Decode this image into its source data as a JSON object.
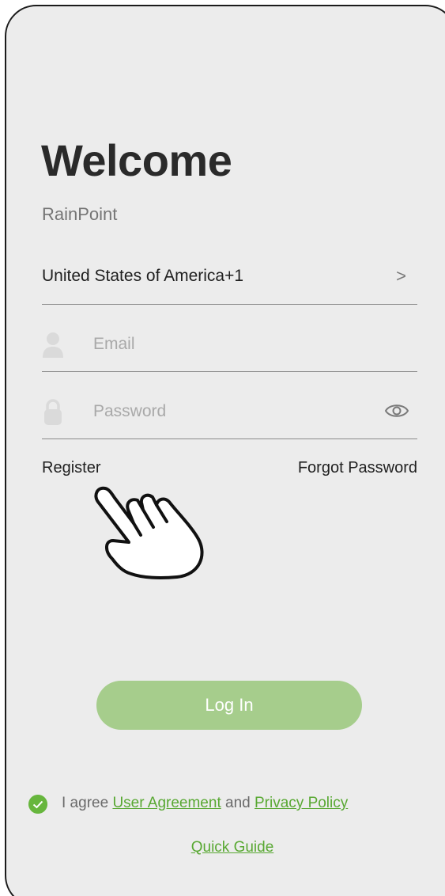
{
  "header": {
    "title": "Welcome",
    "brand": "RainPoint"
  },
  "country": {
    "label": "United States of America+1",
    "chevron": ">"
  },
  "email": {
    "placeholder": "Email",
    "value": "",
    "icon": "person-icon"
  },
  "password": {
    "placeholder": "Password",
    "value": "",
    "icon": "lock-icon",
    "toggle_icon": "eye-icon"
  },
  "links": {
    "register": "Register",
    "forgot": "Forgot Password"
  },
  "login": {
    "label": "Log In",
    "color": "#a6cd8c"
  },
  "agreement": {
    "prefix": "I agree",
    "user_agreement": "User Agreement",
    "and": "and",
    "privacy_policy": "Privacy Policy",
    "checked": true,
    "accent": "#67b63d"
  },
  "quick_guide": "Quick Guide",
  "overlay": {
    "icon": "pointing-hand-icon"
  }
}
